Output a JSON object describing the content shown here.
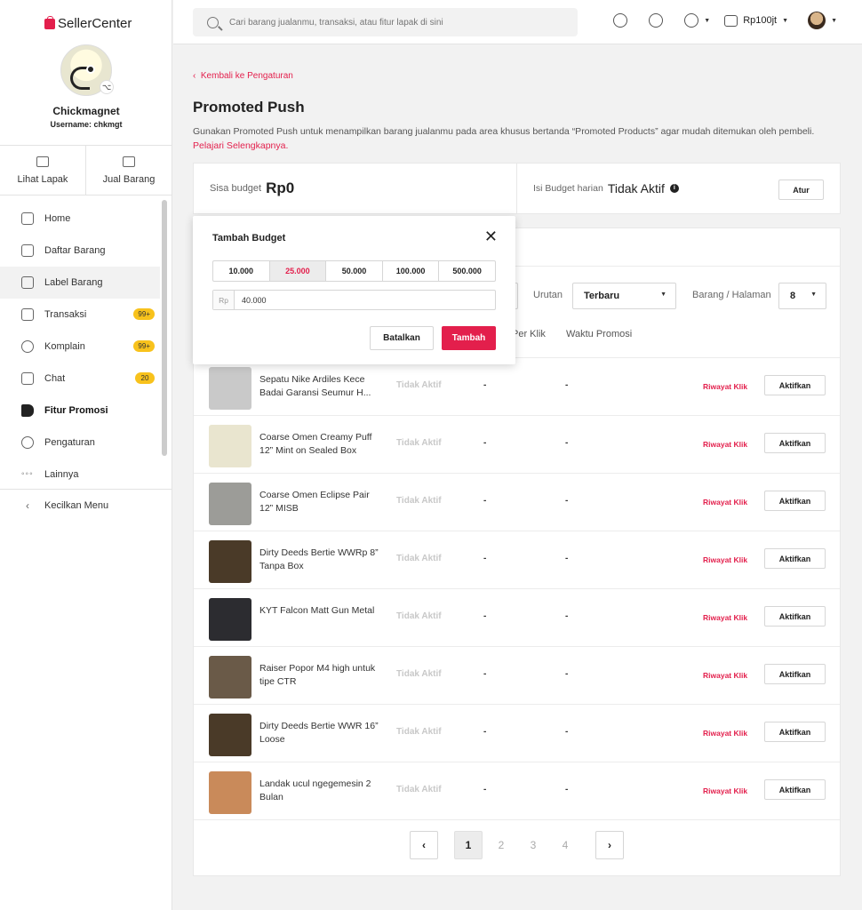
{
  "app": {
    "logo_text": "SellerCenter"
  },
  "profile": {
    "name": "Chickmagnet",
    "username": "Username: chkmgt"
  },
  "quick_actions": [
    {
      "label": "Lihat Lapak",
      "icon": "store-icon"
    },
    {
      "label": "Jual Barang",
      "icon": "add-product-icon"
    }
  ],
  "menu": [
    {
      "label": "Home",
      "icon": "home-icon",
      "badge": ""
    },
    {
      "label": "Daftar Barang",
      "icon": "product-list-icon",
      "badge": ""
    },
    {
      "label": "Label Barang",
      "icon": "label-icon",
      "badge": ""
    },
    {
      "label": "Transaksi",
      "icon": "transaction-icon",
      "badge": "99+"
    },
    {
      "label": "Komplain",
      "icon": "complaint-icon",
      "badge": "99+"
    },
    {
      "label": "Chat",
      "icon": "chat-icon",
      "badge": "20"
    },
    {
      "label": "Fitur Promosi",
      "icon": "megaphone-icon",
      "badge": ""
    },
    {
      "label": "Pengaturan",
      "icon": "settings-icon",
      "badge": ""
    },
    {
      "label": "Lainnya",
      "icon": "more-icon",
      "badge": ""
    }
  ],
  "menu_collapse": "Kecilkan Menu",
  "topbar": {
    "search_placeholder": "Cari barang jualanmu, transaksi, atau fitur lapak di sini",
    "wallet": "Rp100jt"
  },
  "page": {
    "back": "Kembali ke Pengaturan",
    "title": "Promoted Push",
    "desc": "Gunakan Promoted Push untuk menampilkan barang jualanmu pada area khusus bertanda “Promoted Products” agar mudah ditemukan oleh pembeli. ",
    "desc_link": "Pelajari Selengkapnya."
  },
  "budget": {
    "remaining_label": "Sisa budget",
    "remaining_value": "Rp0",
    "daily_label": "Isi Budget harian",
    "daily_value": "Tidak Aktif",
    "set_button": "Atur"
  },
  "filters": {
    "sort_label": "Urutan",
    "sort_value": "Terbaru",
    "per_page_label": "Barang / Halaman",
    "per_page_value": "8"
  },
  "columns": {
    "per_click": "Per Klik",
    "promo_time": "Waktu Promosi"
  },
  "products": [
    {
      "name": "Sepatu Nike Ardiles Kece Badai Garansi Seumur H...",
      "status": "Tidak Aktif",
      "per_click": "-",
      "time": "-",
      "history": "Riwayat Klik",
      "action": "Aktifkan",
      "thumb_color": "#c9c9c9"
    },
    {
      "name": "Coarse Omen Creamy Puff 12” Mint on Sealed Box",
      "status": "Tidak Aktif",
      "per_click": "-",
      "time": "-",
      "history": "Riwayat Klik",
      "action": "Aktifkan",
      "thumb_color": "#e9e5cf"
    },
    {
      "name": "Coarse Omen Eclipse Pair 12” MISB",
      "status": "Tidak Aktif",
      "per_click": "-",
      "time": "-",
      "history": "Riwayat Klik",
      "action": "Aktifkan",
      "thumb_color": "#9c9c98"
    },
    {
      "name": "Dirty Deeds Bertie WWRp 8” Tanpa Box",
      "status": "Tidak Aktif",
      "per_click": "-",
      "time": "-",
      "history": "Riwayat Klik",
      "action": "Aktifkan",
      "thumb_color": "#4a3a28"
    },
    {
      "name": "KYT Falcon Matt Gun Metal",
      "status": "Tidak Aktif",
      "per_click": "-",
      "time": "-",
      "history": "Riwayat Klik",
      "action": "Aktifkan",
      "thumb_color": "#2c2c30"
    },
    {
      "name": "Raiser Popor M4 high untuk tipe CTR",
      "status": "Tidak Aktif",
      "per_click": "-",
      "time": "-",
      "history": "Riwayat Klik",
      "action": "Aktifkan",
      "thumb_color": "#6a5a48"
    },
    {
      "name": "Dirty Deeds Bertie WWR 16” Loose",
      "status": "Tidak Aktif",
      "per_click": "-",
      "time": "-",
      "history": "Riwayat Klik",
      "action": "Aktifkan",
      "thumb_color": "#4a3a28"
    },
    {
      "name": "Landak ucul ngegemesin 2 Bulan",
      "status": "Tidak Aktif",
      "per_click": "-",
      "time": "-",
      "history": "Riwayat Klik",
      "action": "Aktifkan",
      "thumb_color": "#c98a5a"
    }
  ],
  "pagination": {
    "prev": "‹",
    "next": "›",
    "pages": [
      "1",
      "2",
      "3",
      "4"
    ],
    "current": "1"
  },
  "modal": {
    "title": "Tambah Budget",
    "amounts": [
      "10.000",
      "25.000",
      "50.000",
      "100.000",
      "500.000"
    ],
    "selected_amount": "25.000",
    "currency_prefix": "Rp",
    "input_value": "40.000",
    "cancel": "Batalkan",
    "confirm": "Tambah"
  },
  "colors": {
    "accent": "#e31f4c",
    "badge": "#f8c21c"
  }
}
